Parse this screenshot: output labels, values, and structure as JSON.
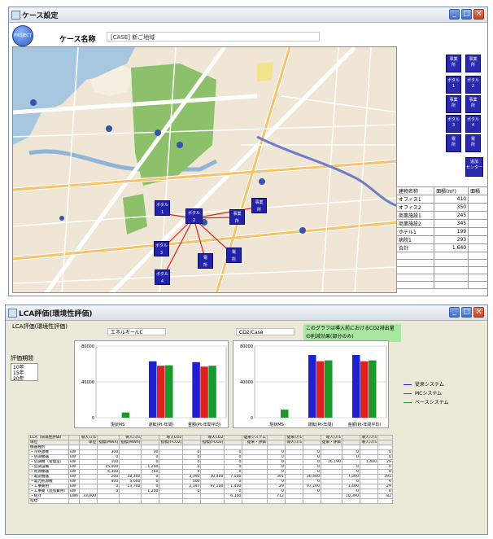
{
  "window1": {
    "title": "ケース設定",
    "logo_text": "PROJECT",
    "case_label": "ケース名称",
    "case_value": "[CASE] 新ご地域",
    "sidebar_buttons": [
      {
        "label": "事業\n所"
      },
      {
        "label": "事業\n所"
      },
      {
        "label": "ボタル\n1"
      },
      {
        "label": "ボタル\n2"
      },
      {
        "label": "事業\n所"
      },
      {
        "label": "事業\n所"
      },
      {
        "label": "ボタル\n3"
      },
      {
        "label": "ボタル\n4"
      },
      {
        "label": "電\n所"
      },
      {
        "label": "電\n所"
      },
      {
        "label": "追加\nセンター"
      }
    ],
    "map_markers": [
      {
        "label": "ボタル\n1"
      },
      {
        "label": "ボタル\n2"
      },
      {
        "label": "事業\n所"
      },
      {
        "label": "事業\n所"
      },
      {
        "label": "ボタル\n3"
      },
      {
        "label": "電\n所"
      },
      {
        "label": "ボタル\n4"
      },
      {
        "label": "電\n所"
      }
    ],
    "table": {
      "headers": [
        "建物名称",
        "面積(m²)",
        "面積"
      ],
      "rows": [
        [
          "オフィス1",
          "410",
          ""
        ],
        [
          "オフィス2",
          "350",
          ""
        ],
        [
          "商業施設1",
          "245",
          ""
        ],
        [
          "商業施設2",
          "345",
          ""
        ],
        [
          "ホテル1",
          "199",
          ""
        ],
        [
          "病院1",
          "293",
          ""
        ],
        [
          "合計",
          "1,640",
          ""
        ],
        [
          "",
          "",
          ""
        ],
        [
          "",
          "",
          ""
        ],
        [
          "",
          "",
          ""
        ],
        [
          "",
          "",
          ""
        ],
        [
          "",
          "",
          ""
        ]
      ]
    }
  },
  "window2": {
    "title": "LCA評価(環境性評価)",
    "subtitle": "LCA評価(環境性評価)",
    "field_energy": "エネルギー/LC",
    "field_co2": "CO2/Case",
    "note": "このグラフは導入前におけるCO2排出量の削減効果(部分のみ)",
    "year_header": "評価期間",
    "year_options": [
      "10年",
      "15年",
      "20年"
    ],
    "year_unit": "年",
    "legend": [
      {
        "name": "従来システム",
        "color": "#1f1fd6"
      },
      {
        "name": "MCシステム",
        "color": "#e01f1f"
      },
      {
        "name": "ベースシステム",
        "color": "#1a9a2a"
      }
    ],
    "table": {
      "rows": [
        [
          "LCA（環境性評価）",
          "",
          "導入ｼｽﾃﾑ",
          "",
          "導入ｼｽﾃﾑ",
          "",
          "導入CO2",
          "",
          "導入CO2",
          "",
          "従来システム",
          "",
          "従来ｼｽﾃﾑ",
          "",
          "導入ｼｽﾃﾑ",
          "",
          "導入ｼｽﾃﾑ",
          ""
        ],
        [
          "単位",
          "",
          "単位",
          "指標[MWh]",
          "指標[MWh]",
          "",
          "指標[t-CO2]",
          "",
          "指標[t-CO2]",
          "",
          "従来・評価",
          "",
          "導入ｼｽﾃﾑ",
          "",
          "従来・評価",
          "",
          "導入ｼｽﾃﾑ",
          ""
        ],
        [
          "機器種別",
          "",
          "",
          "",
          "",
          "",
          "",
          "",
          "",
          "",
          "",
          "",
          "",
          "",
          "",
          "",
          "",
          ""
        ],
        [
          "・冷熱源機",
          "kW",
          "",
          "300",
          "",
          "30",
          "",
          "0",
          "",
          "0",
          "",
          "0",
          "",
          "0",
          "",
          "0",
          "",
          "0"
        ],
        [
          "・空調機器",
          "kW",
          "",
          "0",
          "",
          "0",
          "",
          "0",
          "",
          "0",
          "",
          "0",
          "",
          "0",
          "",
          "0",
          "",
          "0"
        ],
        [
          "・空調機（管理室）",
          "kW",
          "",
          "100",
          "",
          "0",
          "",
          "0",
          "",
          "0",
          "",
          "0",
          "",
          "0",
          "16,190",
          "",
          "1,400",
          "29"
        ],
        [
          "・空調設備",
          "kW",
          "",
          "15,000",
          "",
          "1,200",
          "",
          "0",
          "",
          "0",
          "",
          "0",
          "",
          "0",
          "",
          "0",
          "",
          "0"
        ],
        [
          "・熱源機器",
          "kW",
          "",
          "5,300",
          "",
          "750",
          "",
          "0",
          "",
          "0",
          "",
          "0",
          "",
          "0",
          "",
          "0",
          "",
          "0"
        ],
        [
          "・電気機器",
          "kW",
          "",
          "200",
          "38,300",
          "0",
          "",
          "3,390",
          "30,400",
          "7,500",
          "",
          "391",
          "",
          "30,400",
          "",
          "7,500",
          "",
          "391"
        ],
        [
          "・電力熱源機",
          "kW",
          "",
          "400",
          "5,000",
          "0",
          "",
          "500",
          "",
          "0",
          "",
          "0",
          "",
          "0",
          "",
          "0",
          "",
          "0"
        ],
        [
          "・工事費用",
          "kW",
          "",
          "0",
          "13,700",
          "0",
          "",
          "2,197",
          "97,100",
          "1,400",
          "",
          "29",
          "",
          "97,100",
          "",
          "1,400",
          "",
          "29"
        ],
        [
          "・工事費（追加費用）",
          "kW",
          "",
          "0",
          "",
          "1,200",
          "",
          "0",
          "",
          "0",
          "",
          "0",
          "",
          "0",
          "",
          "0",
          "",
          "0"
        ],
        [
          "・総計",
          "kWh",
          "33,000",
          "",
          "",
          "",
          "",
          "",
          "",
          "6,100",
          "",
          "712",
          "",
          "",
          "",
          "10,390",
          "",
          "82"
        ],
        [
          "指標",
          "",
          "",
          "",
          "",
          "",
          "",
          "",
          "",
          "",
          "",
          "",
          "",
          "",
          "",
          "",
          "",
          ""
        ]
      ]
    }
  },
  "chart_data": [
    {
      "type": "bar",
      "categories": [
        "現状MS",
        "運転(Pt-年間)",
        "金額(Pt-年間平均)"
      ],
      "series": [
        {
          "name": "従来システム",
          "values": [
            0,
            63000,
            62000
          ]
        },
        {
          "name": "MCシステム",
          "values": [
            0,
            58000,
            57000
          ]
        },
        {
          "name": "ベースシステム",
          "values": [
            5800,
            58500,
            58000
          ]
        }
      ],
      "yticks": [
        "80000",
        "40000",
        "0"
      ],
      "ylim": [
        0,
        80000
      ]
    },
    {
      "type": "bar",
      "categories": [
        "現状MS",
        "運転(Pt-年間)",
        "金額(Pt-年間平均)"
      ],
      "series": [
        {
          "name": "従来システム",
          "values": [
            0,
            70000,
            70000
          ]
        },
        {
          "name": "MCシステム",
          "values": [
            0,
            63000,
            63000
          ]
        },
        {
          "name": "ベースシステム",
          "values": [
            9000,
            64000,
            64000
          ]
        }
      ],
      "yticks": [
        "80000",
        "40000",
        "0"
      ],
      "ylim": [
        0,
        80000
      ]
    }
  ]
}
